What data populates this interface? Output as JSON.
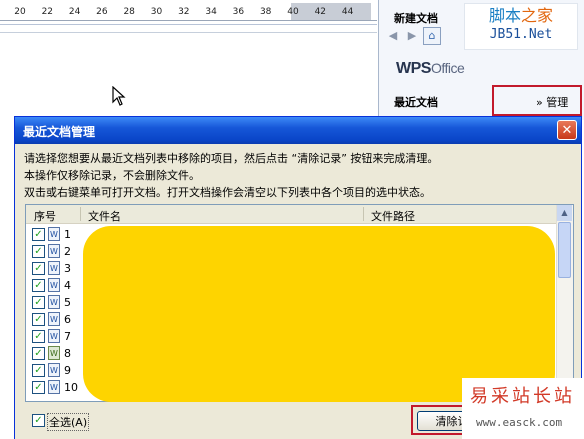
{
  "ruler": {
    "numbers": [
      "20",
      "22",
      "24",
      "26",
      "28",
      "30",
      "32",
      "34",
      "36",
      "38",
      "40",
      "42",
      "44"
    ]
  },
  "task_pane": {
    "title": "新建文档",
    "logo": {
      "brand": "WPS",
      "product": "Office"
    },
    "recent_label": "最近文档",
    "manage_link": "» 管理"
  },
  "site_logo": {
    "line1_a": "脚本",
    "line1_b": "之家",
    "line2": "JB51.Net"
  },
  "dialog": {
    "title": "最近文档管理",
    "close_glyph": "✕",
    "info": [
      "请选择您想要从最近文档列表中移除的项目，然后点击 “清除记录” 按钮来完成清理。",
      "本操作仅移除记录，不会删除文件。",
      "双击或右键菜单可打开文档。打开文档操作会清空以下列表中各个项目的选中状态。"
    ],
    "columns": {
      "index": "序号",
      "name": "文件名",
      "path": "文件路径"
    },
    "rows": [
      {
        "num": "1",
        "checked": true,
        "icon": "W"
      },
      {
        "num": "2",
        "checked": true,
        "icon": "W"
      },
      {
        "num": "3",
        "checked": true,
        "icon": "W"
      },
      {
        "num": "4",
        "checked": true,
        "icon": "W"
      },
      {
        "num": "5",
        "checked": true,
        "icon": "W"
      },
      {
        "num": "6",
        "checked": true,
        "icon": "W"
      },
      {
        "num": "7",
        "checked": true,
        "icon": "W"
      },
      {
        "num": "8",
        "checked": true,
        "icon": "W"
      },
      {
        "num": "9",
        "checked": true,
        "icon": "W"
      },
      {
        "num": "10",
        "checked": true,
        "icon": "W"
      }
    ],
    "select_all": "全选(A)",
    "clear_button": "清除记"
  },
  "watermark": {
    "line1": "易采站长站",
    "line2": "www.easck.com"
  },
  "colors": {
    "redaction": "#fed400",
    "highlight_box": "#c21a2c",
    "title_bar": "#0a45c8"
  }
}
